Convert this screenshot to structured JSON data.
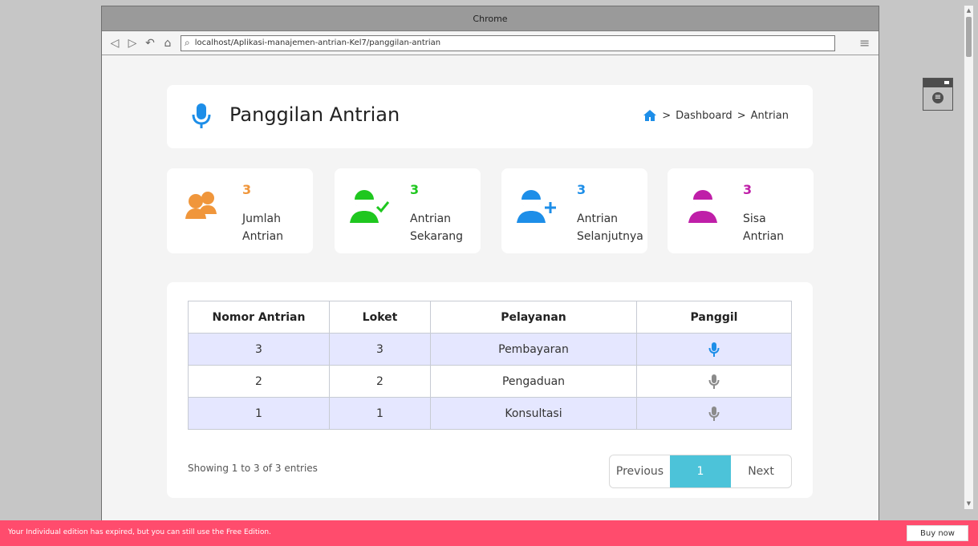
{
  "browser": {
    "title": "Chrome",
    "url": "localhost/Aplikasi-manajemen-antrian-Kel7/panggilan-antrian"
  },
  "header": {
    "title": "Panggilan Antrian",
    "breadcrumb": [
      ">",
      "Dashboard",
      ">",
      "Antrian"
    ]
  },
  "stats": [
    {
      "value": "3",
      "label1": "Jumlah",
      "label2": "Antrian",
      "color": "#f0963b",
      "icon": "users-icon"
    },
    {
      "value": "3",
      "label1": "Antrian",
      "label2": "Sekarang",
      "color": "#1fc71f",
      "icon": "user-check-icon"
    },
    {
      "value": "3",
      "label1": "Antrian",
      "label2": "Selanjutnya",
      "color": "#1d8ee8",
      "icon": "user-plus-icon"
    },
    {
      "value": "3",
      "label1": "Sisa",
      "label2": "Antrian",
      "color": "#bf1fa8",
      "icon": "user-icon"
    }
  ],
  "table": {
    "headers": [
      "Nomor Antrian",
      "Loket",
      "Pelayanan",
      "Panggil"
    ],
    "rows": [
      {
        "nomor": "3",
        "loket": "3",
        "pelayanan": "Pembayaran"
      },
      {
        "nomor": "2",
        "loket": "2",
        "pelayanan": "Pengaduan"
      },
      {
        "nomor": "1",
        "loket": "1",
        "pelayanan": "Konsultasi"
      }
    ]
  },
  "pagination": {
    "summary": "Showing 1 to 3 of 3 entries",
    "previous": "Previous",
    "page": "1",
    "next": "Next"
  },
  "footer": {
    "message": "Your Individual edition has expired, but you can still use the Free Edition.",
    "button": "Buy now"
  }
}
